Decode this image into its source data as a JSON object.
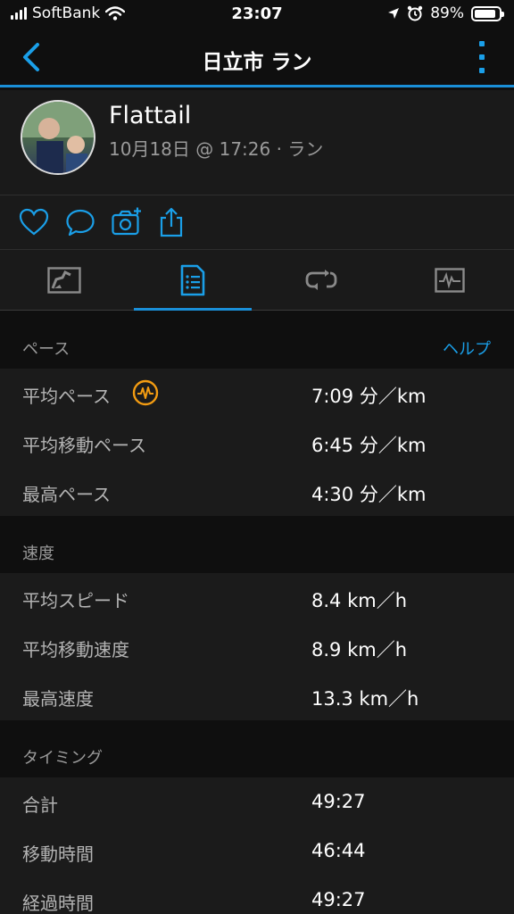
{
  "status_bar": {
    "carrier": "SoftBank",
    "time": "23:07",
    "battery": "89%",
    "battery_level": 0.89
  },
  "nav": {
    "title": "日立市 ラン"
  },
  "activity": {
    "user_name": "Flattail",
    "subtitle": "10月18日 @ 17:26 · ラン"
  },
  "tabs": [
    {
      "icon": "map-icon",
      "active": false
    },
    {
      "icon": "stats-list-icon",
      "active": true
    },
    {
      "icon": "laps-icon",
      "active": false
    },
    {
      "icon": "chart-icon",
      "active": false
    }
  ],
  "sections": {
    "pace": {
      "title": "ペース",
      "help": "ヘルプ",
      "rows": [
        {
          "label": "平均ペース",
          "value": "7:09 分／km"
        },
        {
          "label": "平均移動ペース",
          "value": "6:45 分／km"
        },
        {
          "label": "最高ペース",
          "value": "4:30 分／km"
        }
      ]
    },
    "speed": {
      "title": "速度",
      "rows": [
        {
          "label": "平均スピード",
          "value": "8.4 km／h"
        },
        {
          "label": "平均移動速度",
          "value": "8.9 km／h"
        },
        {
          "label": "最高速度",
          "value": "13.3 km／h"
        }
      ]
    },
    "timing": {
      "title": "タイミング",
      "rows": [
        {
          "label": "合計",
          "value": "49:27"
        },
        {
          "label": "移動時間",
          "value": "46:44"
        },
        {
          "label": "経過時間",
          "value": "49:27"
        }
      ]
    }
  },
  "colors": {
    "accent": "#1a8fd8",
    "link": "#1a9fe8",
    "hr_badge": "#f39c12",
    "background": "#0f0f0f",
    "card": "#1b1b1b"
  }
}
